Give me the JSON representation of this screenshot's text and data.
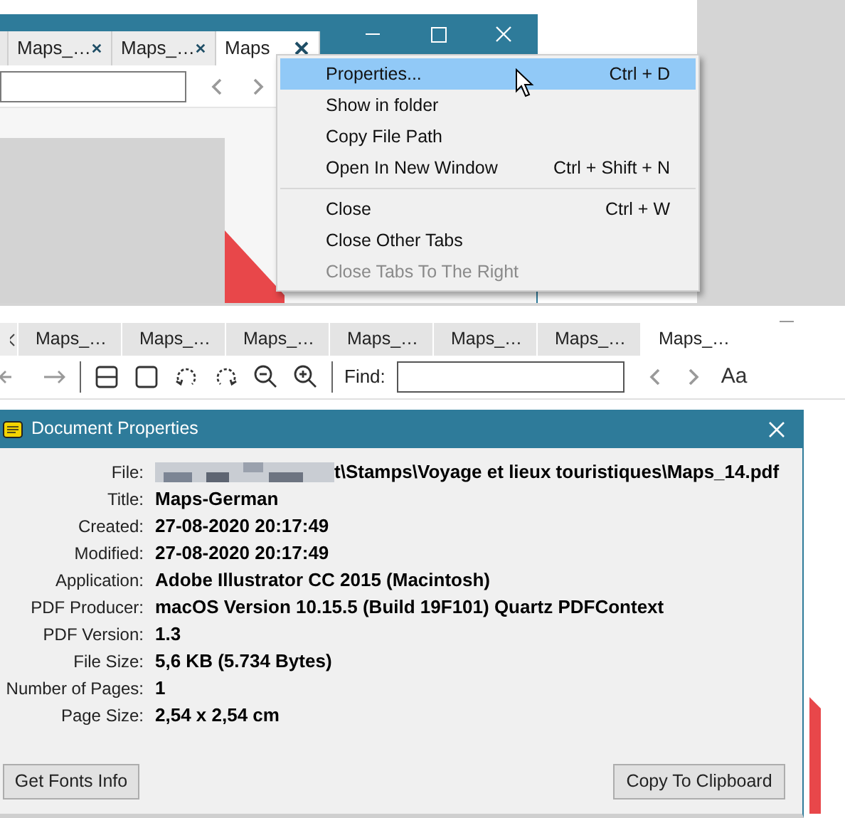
{
  "top_window": {
    "tabs": [
      {
        "label": "Maps_…",
        "selected": false
      },
      {
        "label": "Maps_…",
        "selected": false
      },
      {
        "label": "Maps",
        "selected": true
      }
    ]
  },
  "context_menu": {
    "groups": [
      [
        {
          "label": "Properties...",
          "shortcut": "Ctrl + D",
          "selected": true,
          "disabled": false
        },
        {
          "label": "Show in folder",
          "selected": false,
          "disabled": false
        },
        {
          "label": "Copy File Path",
          "selected": false,
          "disabled": false
        },
        {
          "label": "Open In New Window",
          "shortcut": "Ctrl + Shift + N",
          "selected": false,
          "disabled": false
        }
      ],
      [
        {
          "label": "Close",
          "shortcut": "Ctrl + W",
          "selected": false,
          "disabled": false
        },
        {
          "label": "Close Other Tabs",
          "selected": false,
          "disabled": false
        },
        {
          "label": "Close Tabs To The Right",
          "selected": false,
          "disabled": true
        }
      ]
    ]
  },
  "bottom_window": {
    "tabs": [
      {
        "label": "Maps_…",
        "selected": false
      },
      {
        "label": "Maps_…",
        "selected": false
      },
      {
        "label": "Maps_…",
        "selected": false
      },
      {
        "label": "Maps_…",
        "selected": false
      },
      {
        "label": "Maps_…",
        "selected": false
      },
      {
        "label": "Maps_…",
        "selected": false
      },
      {
        "label": "Maps_…",
        "selected": true
      }
    ],
    "find_label": "Find:",
    "match_case": "Aa"
  },
  "dialog": {
    "title": "Document Properties",
    "fields": [
      {
        "label": "File:",
        "value": "t\\Stamps\\Voyage et lieux touristiques\\Maps_14.pdf",
        "redacted": true
      },
      {
        "label": "Title:",
        "value": "Maps-German"
      },
      {
        "label": "Created:",
        "value": "27-08-2020 20:17:49"
      },
      {
        "label": "Modified:",
        "value": "27-08-2020 20:17:49"
      },
      {
        "label": "Application:",
        "value": "Adobe Illustrator CC 2015 (Macintosh)"
      },
      {
        "label": "PDF Producer:",
        "value": "macOS Version 10.15.5 (Build 19F101) Quartz PDFContext"
      },
      {
        "label": "PDF Version:",
        "value": "1.3"
      },
      {
        "label": "File Size:",
        "value": "5,6 KB (5.734 Bytes)"
      },
      {
        "label": "Number of Pages:",
        "value": "1"
      },
      {
        "label": "Page Size:",
        "value": "2,54 x 2,54 cm"
      }
    ],
    "buttons": [
      "Get Fonts Info",
      "Copy To Clipboard"
    ]
  }
}
